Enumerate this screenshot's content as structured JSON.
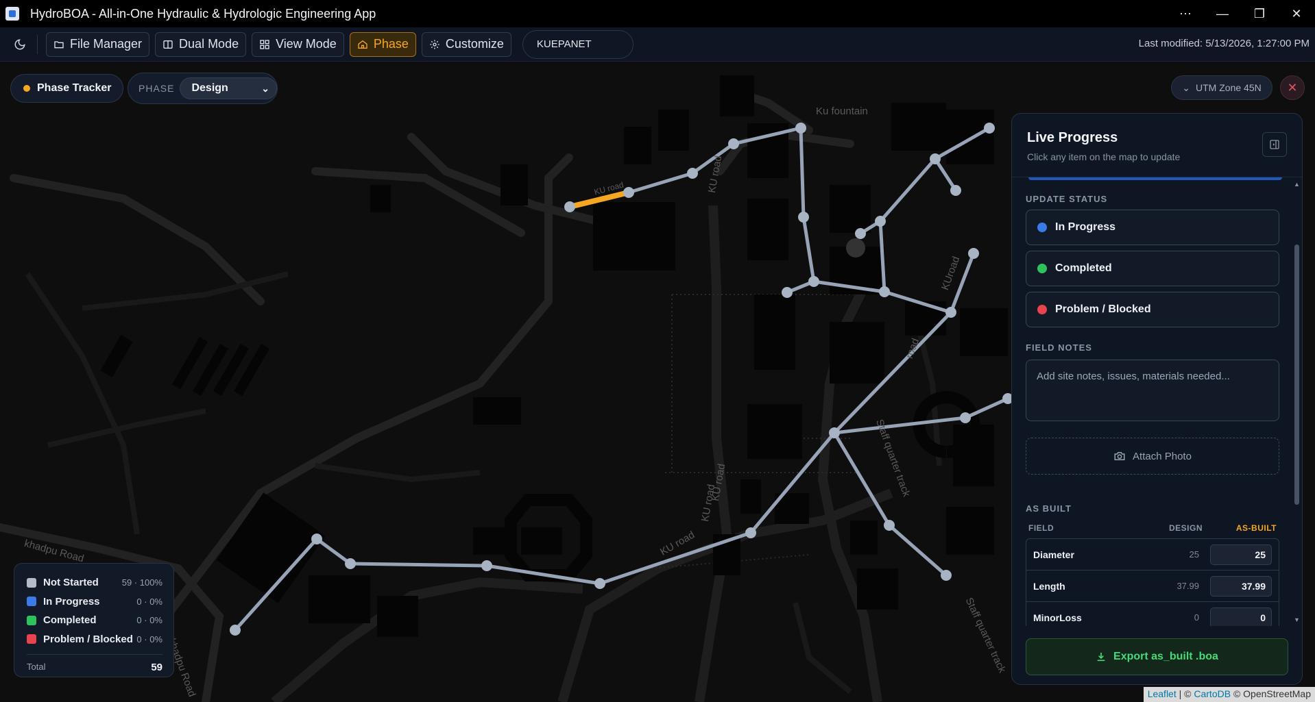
{
  "window": {
    "title": "HydroBOA - All-in-One Hydraulic & Hydrologic Engineering App",
    "controls": [
      "⋯",
      "—",
      "❐",
      "✕"
    ]
  },
  "toolbar": {
    "file_manager": "File Manager",
    "dual_mode": "Dual Mode",
    "view_mode": "View Mode",
    "phase": "Phase",
    "customize": "Customize",
    "project": "KUEPANET",
    "last_modified": "Last modified: 5/13/2026, 1:27:00 PM"
  },
  "phase_tracker": {
    "label": "Phase Tracker",
    "phase_label": "PHASE",
    "phase_value": "Design"
  },
  "map": {
    "crs": "UTM Zone 45N",
    "labels": {
      "fountain": "Ku fountain",
      "ku_road_1": "KU road",
      "ku_road_2": "KU road",
      "ku_road_3": "KU road",
      "ku_road_4": "KU road",
      "kuroad": "KUroad",
      "road_mid": "road",
      "staff_track": "Staff quarter track",
      "staff_track_2": "Staff quarter track",
      "khadpu": "khadpu Road",
      "khadpu_2": "khadpu Road",
      "ku_top": "KU road"
    },
    "attribution": {
      "leaflet": "Leaflet",
      "sep": " | © ",
      "carto": "CartoDB",
      "osm": " © OpenStreetMap"
    }
  },
  "legend": {
    "items": [
      {
        "name": "Not Started",
        "count": "59 · 100%",
        "color": "#b4bcc9"
      },
      {
        "name": "In Progress",
        "count": "0 · 0%",
        "color": "#3b7be8"
      },
      {
        "name": "Completed",
        "count": "0 · 0%",
        "color": "#2ec25c"
      },
      {
        "name": "Problem / Blocked",
        "count": "0 · 0%",
        "color": "#e8434f"
      }
    ],
    "total_label": "Total",
    "total_value": "59"
  },
  "panel": {
    "title": "Live Progress",
    "subtitle": "Click any item on the map to update",
    "update_status_label": "UPDATE STATUS",
    "statuses": [
      {
        "label": "In Progress",
        "color": "#3b7be8"
      },
      {
        "label": "Completed",
        "color": "#2ec25c"
      },
      {
        "label": "Problem / Blocked",
        "color": "#e8434f"
      }
    ],
    "field_notes_label": "FIELD NOTES",
    "field_notes_placeholder": "Add site notes, issues, materials needed...",
    "attach_photo": "Attach Photo",
    "as_built_label": "AS BUILT",
    "columns": {
      "field": "FIELD",
      "design": "DESIGN",
      "as_built": "AS-BUILT"
    },
    "rows": [
      {
        "field": "Diameter",
        "design": "25",
        "as_built": "25"
      },
      {
        "field": "Length",
        "design": "37.99",
        "as_built": "37.99"
      },
      {
        "field": "MinorLoss",
        "design": "0",
        "as_built": "0"
      }
    ],
    "export": "Export as_built .boa"
  },
  "colors": {
    "accent": "#f5a623",
    "pipe": "#97a3b6",
    "selected_pipe": "#f5a623"
  }
}
